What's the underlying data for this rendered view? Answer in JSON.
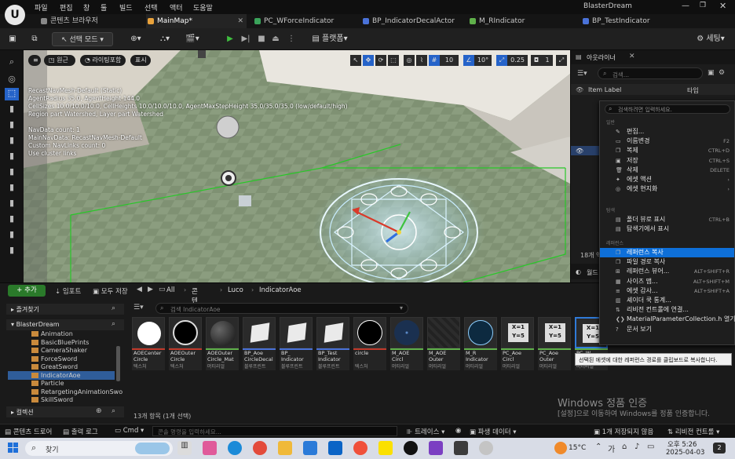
{
  "app": {
    "logo": "U",
    "window_title": "BlasterDream"
  },
  "menu": [
    "파일",
    "편집",
    "창",
    "툴",
    "빌드",
    "선택",
    "액터",
    "도움말"
  ],
  "tabs": [
    {
      "label": "콘텐츠 브라우저",
      "color": "#888888"
    },
    {
      "label": "MainMap*",
      "color": "#e9a23b"
    },
    {
      "label": "PC_WForceIndicator",
      "color": "#3aa35a"
    },
    {
      "label": "BP_IndicatorDecalActor",
      "color": "#4a72d8"
    },
    {
      "label": "M_RIndicator",
      "color": "#5fb04a"
    },
    {
      "label": "BP_TestIndicator",
      "color": "#4a72d8"
    }
  ],
  "toolbar": {
    "mode": "선택 모드",
    "platforms": "플랫폼",
    "settings": "세팅"
  },
  "viewport": {
    "buttons": [
      "원근",
      "라이팅포함",
      "표시"
    ],
    "snap_grid": "10",
    "snap_angle": "10°",
    "snap_scale": "0.25",
    "camera_speed": "1",
    "stats": [
      "RecastNavMesh-Default (Static)",
      "AgentRadius 35.0, AgentHeight 144.0",
      "CellSizes 10.0/10.0/10.0, CellHeights 10.0/10.0/10.0, AgentMaxStepHeight 35.0/35.0/35.0 (low/default/high)",
      "Region part Watershed, Layer part Watershed",
      "",
      "NavData count: 1",
      "MainNavData: RecastNavMesh-Default",
      "Custom NavLinks count: 0",
      "Use cluster links"
    ]
  },
  "outliner": {
    "title": "아웃라이너",
    "search_placeholder": "검색...",
    "col_label": "Item Label",
    "col_type": "타입",
    "count_text": "18개 액",
    "details_label": "디테",
    "world_label": "월드"
  },
  "context_menu": {
    "search_placeholder": "검색하려면 입력하세요.",
    "sections": {
      "general": "일반",
      "explore": "탐색",
      "references": "레퍼런스"
    },
    "items_general": [
      {
        "label": "편집...",
        "shortcut": "",
        "icon": "✎"
      },
      {
        "label": "이름변경",
        "shortcut": "F2",
        "icon": "▭"
      },
      {
        "label": "복제",
        "shortcut": "CTRL+D",
        "icon": "❐"
      },
      {
        "label": "저장",
        "shortcut": "CTRL+S",
        "icon": "▣"
      },
      {
        "label": "삭제",
        "shortcut": "DELETE",
        "icon": "🗑"
      },
      {
        "label": "에셋 액션",
        "shortcut": "›",
        "icon": "✦"
      },
      {
        "label": "에셋 현지화",
        "shortcut": "›",
        "icon": "◎"
      }
    ],
    "items_explore": [
      {
        "label": "폴더 뷰로 표시",
        "shortcut": "CTRL+B",
        "icon": "▤"
      },
      {
        "label": "탐색기에서 표시",
        "shortcut": "",
        "icon": "▤"
      }
    ],
    "items_refs": [
      {
        "label": "레퍼런스 복사",
        "shortcut": "",
        "icon": "❐",
        "hl": true
      },
      {
        "label": "파일 경로 복사",
        "shortcut": "",
        "icon": "❐"
      },
      {
        "label": "레퍼런스 뷰어...",
        "shortcut": "ALT+SHIFT+R",
        "icon": "⊞"
      },
      {
        "label": "사이즈 맵...",
        "shortcut": "ALT+SHIFT+M",
        "icon": "▦"
      },
      {
        "label": "에셋 감사...",
        "shortcut": "ALT+SHIFT+A",
        "icon": "≡"
      },
      {
        "label": "셰이더 쿡 통계...",
        "shortcut": "",
        "icon": "▥"
      },
      {
        "label": "리비전 컨트롤에 연결...",
        "shortcut": "",
        "icon": "⇅"
      },
      {
        "label": "MaterialParameterCollection.h 열기",
        "shortcut": "",
        "icon": "❮❯"
      },
      {
        "label": "문서 보기",
        "shortcut": "",
        "icon": "?"
      }
    ],
    "tooltip": "선택된 에셋에 대한 레퍼런스 경로를 클립보드로 복사합니다."
  },
  "content_browser": {
    "add": "+ 추가",
    "import": "임포트",
    "save_all": "모두 저장",
    "path": [
      "All",
      "콘텐츠",
      "Luco",
      "IndicatorAoe"
    ],
    "search_placeholder": "검색 IndicatorAoe",
    "favorites": "즐겨찾기",
    "project": "BlasterDream",
    "collections": "컬렉션",
    "folders": [
      "Animation",
      "BasicBluePrints",
      "CameraShaker",
      "ForceSword",
      "GreatSword",
      "IndicatorAoe",
      "Particle",
      "RetargetingAnimationSwo",
      "SkillSword"
    ],
    "selected_folder": "IndicatorAoe",
    "count": "13개 항목 (1개 선택)",
    "assets": [
      {
        "name": "AOECenter Circle",
        "type": "텍스처",
        "kind": "white",
        "stripe": "#c0392b"
      },
      {
        "name": "AOEOuter Circle",
        "type": "텍스처",
        "kind": "ring",
        "stripe": "#c0392b"
      },
      {
        "name": "AOEOuter Circle_Mat",
        "type": "머티리얼",
        "kind": "sphere",
        "stripe": "#5fb04a"
      },
      {
        "name": "BP_Aoe CircleDecal",
        "type": "블루프린트",
        "kind": "paper",
        "stripe": "#4a72d8"
      },
      {
        "name": "BP_ Indicator",
        "type": "블루프린트",
        "kind": "paper",
        "stripe": "#4a72d8"
      },
      {
        "name": "BP_Test Indicator",
        "type": "블루프린트",
        "kind": "paper",
        "stripe": "#4a72d8"
      },
      {
        "name": "circle",
        "type": "텍스처",
        "kind": "circle",
        "stripe": "#c0392b"
      },
      {
        "name": "M_AOE Circl",
        "type": "머티리얼",
        "kind": "bluedots",
        "stripe": "#5fb04a"
      },
      {
        "name": "M_AOE Outer",
        "type": "머티리얼",
        "kind": "dark",
        "stripe": "#5fb04a"
      },
      {
        "name": "M_R Indicator",
        "type": "머티리얼",
        "kind": "bluedots2",
        "stripe": "#5fb04a"
      },
      {
        "name": "PC_Aoe Circl",
        "type": "머티리얼",
        "kind": "xy",
        "stripe": "#5fb04a"
      },
      {
        "name": "PC_Aoe Outer",
        "type": "머티리얼",
        "kind": "xy",
        "stripe": "#5fb04a"
      },
      {
        "name": "PC_W",
        "type": "머티리얼",
        "kind": "xysel",
        "stripe": "#5fb04a"
      }
    ]
  },
  "statusbar": {
    "drawer": "콘텐츠 드로어",
    "log": "출력 로그",
    "cmd": "Cmd",
    "cmd_placeholder": "콘솔 명령을 입력하세요...",
    "trace": "트레이스",
    "derived": "파생 데이터",
    "unsaved": "1개 저장되지 않음",
    "revision": "리비전 컨트롤"
  },
  "watermark": {
    "line1": "Windows 정품 인증",
    "line2": "[설정]으로 이동하여 Windows를 정품 인증합니다."
  },
  "taskbar": {
    "search": "찾기",
    "temp": "15°C",
    "time": "오후 5:26",
    "date": "2025-04-03",
    "notif": "2"
  }
}
